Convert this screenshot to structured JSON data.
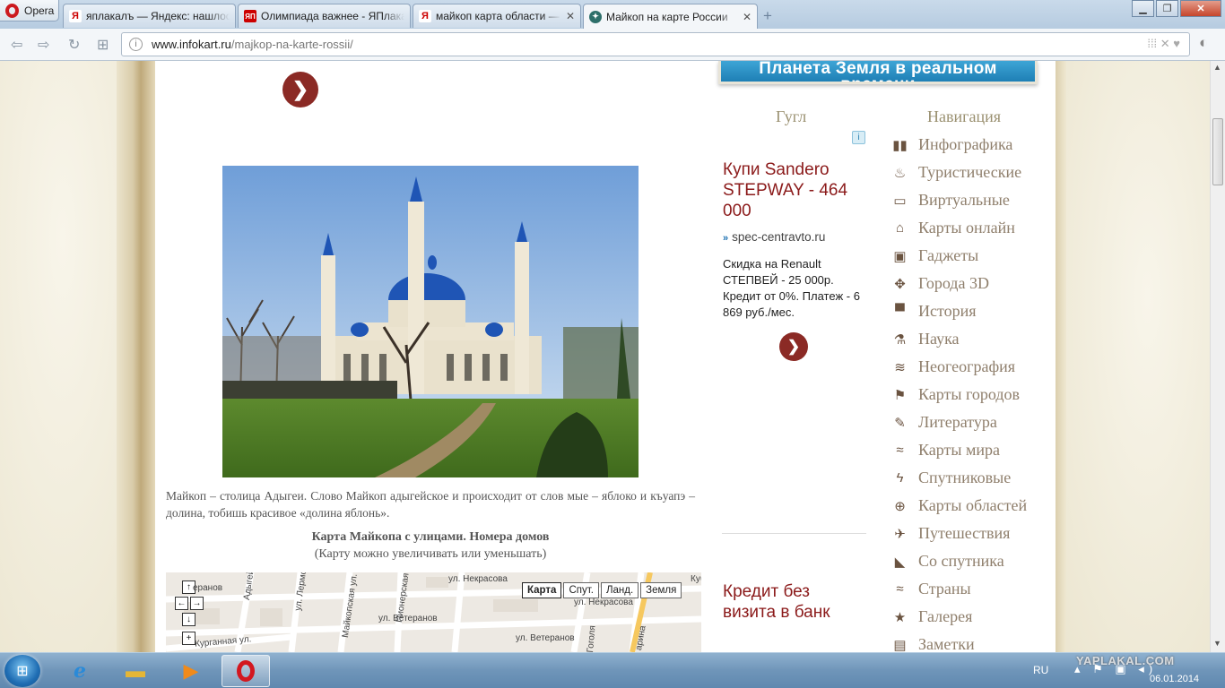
{
  "browser": {
    "menu_label": "Opera",
    "tabs": [
      {
        "title": "яплакалъ — Яндекс: нашлось",
        "favicon": "Я"
      },
      {
        "title": "Олимпиада важнее - ЯПлакалъ",
        "favicon": "ЯП"
      },
      {
        "title": "майкоп карта области — Яндекс",
        "favicon": "Я"
      },
      {
        "title": "Майкоп на карте России",
        "favicon": "✦"
      }
    ],
    "new_tab": "+",
    "url_domain": "www.infokart.ru",
    "url_path": "/majkop-na-karte-rossii/"
  },
  "page": {
    "top_banner_text": "Планета Земля в реальном времени",
    "caption": "Майкоп – столица Адыгеи. Слово Майкоп адыгейское и происходит от слов мые – яблоко и къуапэ – долина, тобишь красивое «долина яблонь».",
    "map_title": "Карта Майкопа с улицами. Номера домов",
    "map_subtitle": "(Карту можно увеличивать или уменьшать)",
    "map": {
      "types": [
        "Карта",
        "Спут.",
        "Ланд.",
        "Земля"
      ],
      "selected_type": "Карта",
      "streets": {
        "s1": "еранов",
        "s2": "Адыгейская",
        "s3": "ул. Лермо",
        "s4": "Майкопская ул.",
        "s5": "Пионерская ул.",
        "s6": "ул. Некрасова",
        "s7": "ул. Некрасова",
        "s8": "ул. Ветеранов",
        "s9": "ул. Ветеранов",
        "s10": "Курганная ул.",
        "s11": "Кубанс",
        "s12": "арина",
        "s13": "Гоголя"
      }
    },
    "ad": {
      "heading": "Гугл",
      "info_icon": "i",
      "title": "Купи Sandero STEPWAY - 464 000",
      "url": "spec-centravto.ru",
      "text": "Скидка на Renault СТЕПВЕЙ - 25 000р. Кредит от 0%. Платеж - 6 869 руб./мес.",
      "ad2_title": "Кредит без визита в банк"
    },
    "nav": {
      "heading": "Навигация",
      "items": [
        {
          "icon": "bar-chart-icon",
          "glyph": "▮▮",
          "label": "Инфографика"
        },
        {
          "icon": "camp-fire-icon",
          "glyph": "♨",
          "label": "Туристические"
        },
        {
          "icon": "monitor-icon",
          "glyph": "▭",
          "label": "Виртуальные"
        },
        {
          "icon": "home-icon",
          "glyph": "⌂",
          "label": "Карты онлайн"
        },
        {
          "icon": "speaker-icon",
          "glyph": "▣",
          "label": "Гаджеты"
        },
        {
          "icon": "compass-icon",
          "glyph": "✥",
          "label": "Города 3D"
        },
        {
          "icon": "book-icon",
          "glyph": "▀",
          "label": "История"
        },
        {
          "icon": "flask-icon",
          "glyph": "⚗",
          "label": "Наука"
        },
        {
          "icon": "layers-icon",
          "glyph": "≋",
          "label": "Неогеография"
        },
        {
          "icon": "flag-icon",
          "glyph": "⚑",
          "label": "Карты городов"
        },
        {
          "icon": "edit-icon",
          "glyph": "✎",
          "label": "Литература"
        },
        {
          "icon": "world-map-icon",
          "glyph": "≈",
          "label": "Карты мира"
        },
        {
          "icon": "lightning-icon",
          "glyph": "ϟ",
          "label": "Спутниковые"
        },
        {
          "icon": "globe-icon",
          "glyph": "⊕",
          "label": "Карты областей"
        },
        {
          "icon": "airplane-icon",
          "glyph": "✈",
          "label": "Путешествия"
        },
        {
          "icon": "satellite-dish-icon",
          "glyph": "◣",
          "label": "Со спутника"
        },
        {
          "icon": "world-map-icon",
          "glyph": "≈",
          "label": "Страны"
        },
        {
          "icon": "star-icon",
          "glyph": "★",
          "label": "Галерея"
        },
        {
          "icon": "notebook-icon",
          "glyph": "▤",
          "label": "Заметки"
        }
      ]
    }
  },
  "taskbar": {
    "lang": "RU",
    "watermark": "YAPLAKAL.COM",
    "date": "06.01.2014"
  },
  "colors": {
    "accent_red": "#8b2a25",
    "nav_text": "#8f7f6c",
    "ad_title": "#8b1a1a"
  }
}
